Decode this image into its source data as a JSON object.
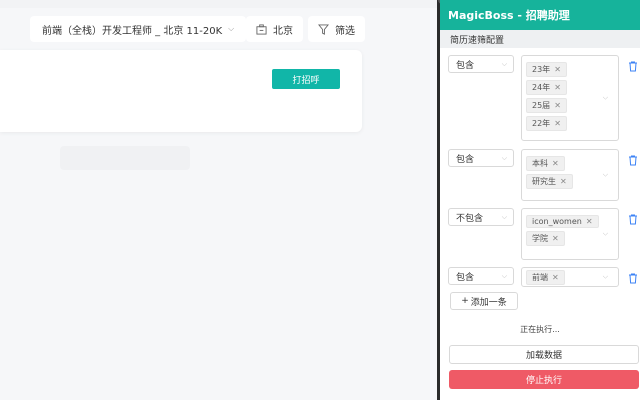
{
  "job_bar": {
    "job": "前端（全栈）开发工程师 _ 北京 11-20K",
    "city": "北京",
    "filter": "筛选"
  },
  "card": {
    "greet_button": "打招呼"
  },
  "panel": {
    "title": "MagicBoss - 招聘助理",
    "subtitle": "简历速筛配置",
    "rules": [
      {
        "mode": "包含",
        "tags": [
          "23年",
          "24年",
          "25届",
          "22年"
        ]
      },
      {
        "mode": "包含",
        "tags": [
          "本科",
          "研究生"
        ]
      },
      {
        "mode": "不包含",
        "tags": [
          "icon_women",
          "学院"
        ]
      },
      {
        "mode": "包含",
        "tags": [
          "前端"
        ]
      }
    ],
    "add_rule": "添加一条",
    "status": "正在执行...",
    "load_button": "加载数据",
    "stop_button": "停止执行"
  },
  "colors": {
    "brand": "#16b39b",
    "greet": "#11b6a8",
    "stop": "#ef5a66"
  },
  "icons": [
    "chevron-down-icon",
    "building-icon",
    "filter-icon",
    "close-icon",
    "trash-icon",
    "plus-icon"
  ]
}
